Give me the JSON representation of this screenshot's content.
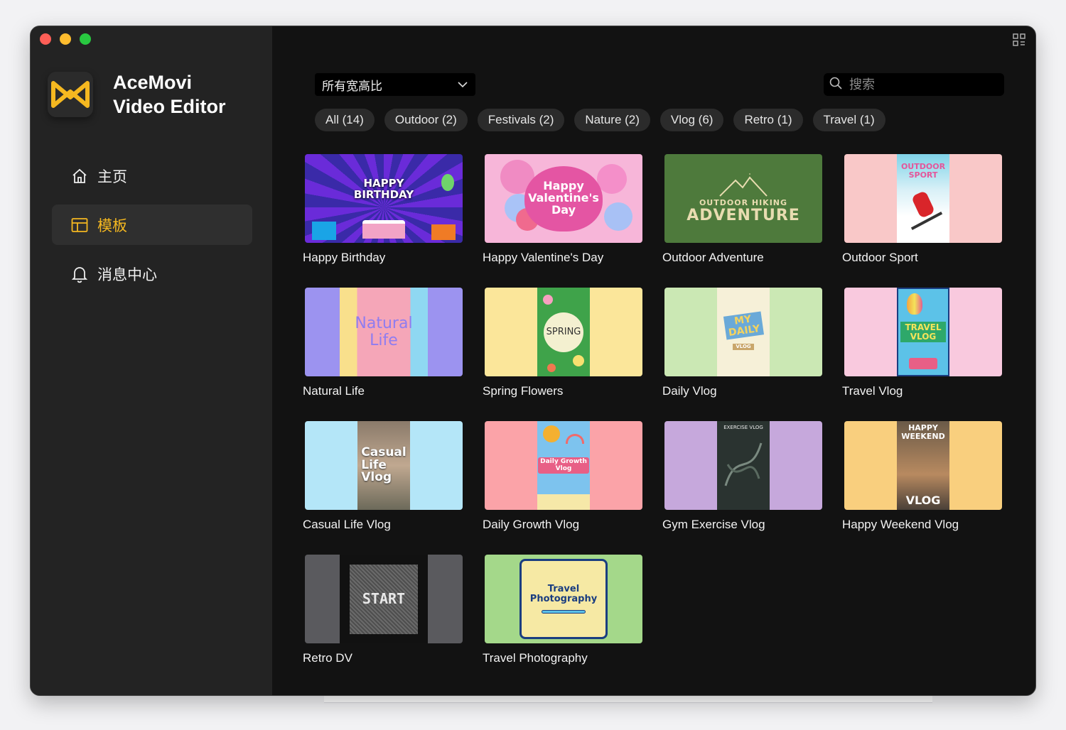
{
  "app": {
    "brand_line1": "AceMovi",
    "brand_line2": "Video Editor",
    "accent_color": "#f5b820"
  },
  "sidebar": {
    "items": [
      {
        "label": "主页",
        "icon": "home-icon",
        "active": false
      },
      {
        "label": "模板",
        "icon": "template-icon",
        "active": true
      },
      {
        "label": "消息中心",
        "icon": "bell-icon",
        "active": false
      }
    ]
  },
  "toolbar": {
    "ratio_selected": "所有宽高比",
    "search_placeholder": "搜索"
  },
  "filters": [
    {
      "label": "All (14)"
    },
    {
      "label": "Outdoor (2)"
    },
    {
      "label": "Festivals (2)"
    },
    {
      "label": "Nature (2)"
    },
    {
      "label": "Vlog (6)"
    },
    {
      "label": "Retro (1)"
    },
    {
      "label": "Travel (1)"
    }
  ],
  "templates": [
    {
      "title": "Happy Birthday",
      "overlay": "HAPPY\nBIRTHDAY"
    },
    {
      "title": "Happy Valentine's Day",
      "overlay": "Happy\nValentine's\nDay"
    },
    {
      "title": "Outdoor Adventure",
      "overlay_small": "OUTDOOR HIKING",
      "overlay": "ADVENTURE"
    },
    {
      "title": "Outdoor Sport",
      "overlay": "OUTDOOR\nSPORT"
    },
    {
      "title": "Natural Life",
      "overlay": "Natural\nLife"
    },
    {
      "title": "Spring Flowers",
      "overlay": "SPRING"
    },
    {
      "title": "Daily Vlog",
      "overlay": "MY\nDAILY",
      "overlay_small": "VLOG"
    },
    {
      "title": "Travel Vlog",
      "overlay": "TRAVEL\nVLOG"
    },
    {
      "title": "Casual Life Vlog",
      "overlay": "Casual\nLife\nVlog"
    },
    {
      "title": "Daily Growth Vlog",
      "overlay": "Daily Growth\nVlog"
    },
    {
      "title": "Gym Exercise Vlog",
      "overlay": "EXERCISE VLOG"
    },
    {
      "title": "Happy Weekend Vlog",
      "overlay_small": "HAPPY\nWEEKEND",
      "overlay": "VLOG"
    },
    {
      "title": "Retro DV",
      "overlay": "START"
    },
    {
      "title": "Travel Photography",
      "overlay": "Travel\nPhotography"
    }
  ]
}
